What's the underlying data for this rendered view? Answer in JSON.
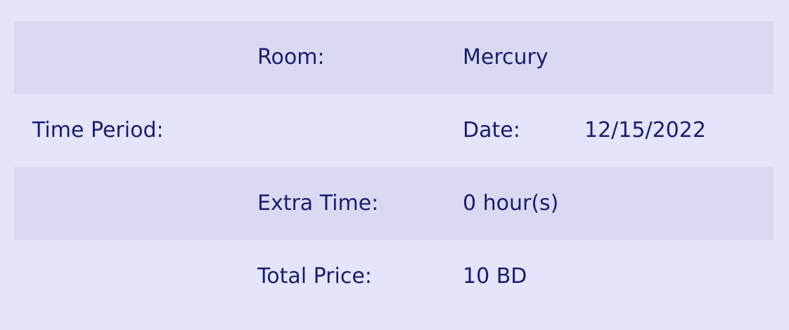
{
  "rows": [
    {
      "col1": "",
      "col2": "Room:",
      "col3": "Mercury",
      "col4": ""
    },
    {
      "col1": "Time Period:",
      "col2": "",
      "col3": "Date:",
      "col4": "12/15/2022"
    },
    {
      "col1": "",
      "col2": "Extra Time:",
      "col3": "0 hour(s)",
      "col4": ""
    },
    {
      "col1": "",
      "col2": "Total Price:",
      "col3": "10 BD",
      "col4": ""
    }
  ]
}
